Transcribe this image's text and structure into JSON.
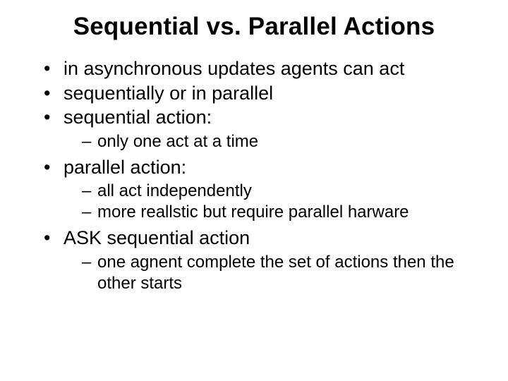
{
  "title": "Sequential vs. Parallel Actions",
  "bullets": {
    "b0": "in asynchronous updates agents can act",
    "b1": "sequentially or in parallel",
    "b2": "sequential action:",
    "b2_sub": {
      "s0": "only one act at a time"
    },
    "b3": "parallel action:",
    "b3_sub": {
      "s0": "all act independently",
      "s1": "more reallstic but require parallel harware"
    },
    "b4": "ASK sequential action",
    "b4_sub": {
      "s0": "one agnent complete the set of actions then the other starts"
    }
  }
}
